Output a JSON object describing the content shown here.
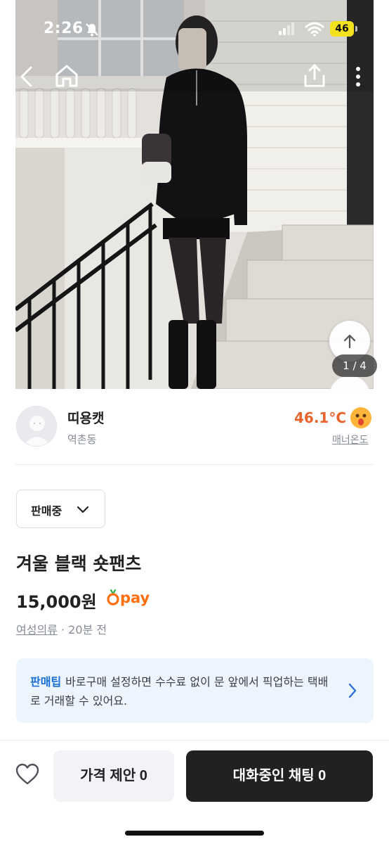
{
  "status_bar": {
    "time": "2:26",
    "battery": "46"
  },
  "photo": {
    "page_current": "1",
    "page_total": "4",
    "page_separator": " / "
  },
  "seller": {
    "name": "띠용캣",
    "location": "역촌동",
    "temperature": "46.1°C",
    "manner_label": "매너온도"
  },
  "product": {
    "status": "판매중",
    "title": "겨울 블랙 숏팬츠",
    "price": "15,000원",
    "pay_label": "pay",
    "category": "여성의류",
    "time_sep": " · ",
    "posted": "20분 전"
  },
  "tip": {
    "tag": "판매팁",
    "text": "바로구매 설정하면 수수료 없이 문 앞에서 픽업하는 택배로 거래할 수 있어요."
  },
  "actions": {
    "offer_label": "가격 제안 0",
    "chat_label": "대화중인 채팅 0"
  },
  "colors": {
    "accent_orange": "#ff6f0f",
    "temperature": "#e8642c",
    "tip_background": "#ecf5fe",
    "tip_tag": "#1a6ed8",
    "primary_button": "#212124"
  }
}
